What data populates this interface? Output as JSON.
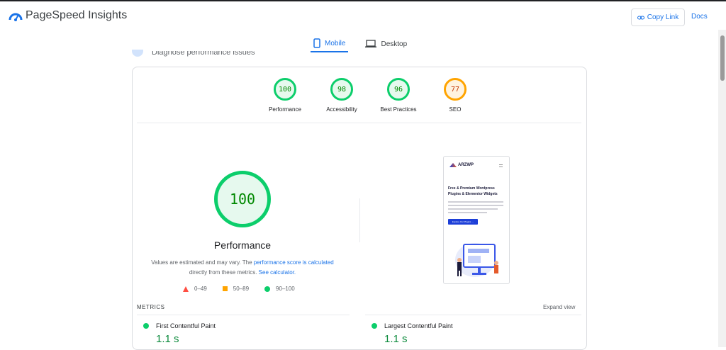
{
  "header": {
    "brand": "PageSpeed Insights",
    "copy_link": "Copy Link",
    "docs": "Docs"
  },
  "tabs": [
    {
      "label": "Mobile",
      "icon": "phone-icon",
      "active": true
    },
    {
      "label": "Desktop",
      "icon": "laptop-icon",
      "active": false
    }
  ],
  "diagnose_heading": "Diagnose performance issues",
  "scores": [
    {
      "value": "100",
      "label": "Performance",
      "status": "pass"
    },
    {
      "value": "98",
      "label": "Accessibility",
      "status": "pass"
    },
    {
      "value": "96",
      "label": "Best Practices",
      "status": "pass"
    },
    {
      "value": "77",
      "label": "SEO",
      "status": "average"
    }
  ],
  "performance": {
    "score": "100",
    "title": "Performance",
    "note_prefix": "Values are estimated and may vary. The ",
    "note_link1": "performance score is calculated",
    "note_middle": " directly from these metrics. ",
    "note_link2": "See calculator."
  },
  "legend": {
    "fail": "0–49",
    "average": "50–89",
    "pass": "90–100"
  },
  "screenshot": {
    "logo": "ARZWP",
    "headline": "Free & Premium Wordpress Plugins & Elementor Widgets",
    "button": "Explore Our Plugins →"
  },
  "metrics": {
    "label": "METRICS",
    "expand": "Expand view",
    "items": [
      {
        "name": "First Contentful Paint",
        "value": "1.1 s"
      },
      {
        "name": "Largest Contentful Paint",
        "value": "1.1 s"
      }
    ]
  },
  "colors": {
    "pass": "#0cce6b",
    "average": "#ffa400",
    "fail": "#ff4e42",
    "accent": "#1a73e8"
  }
}
